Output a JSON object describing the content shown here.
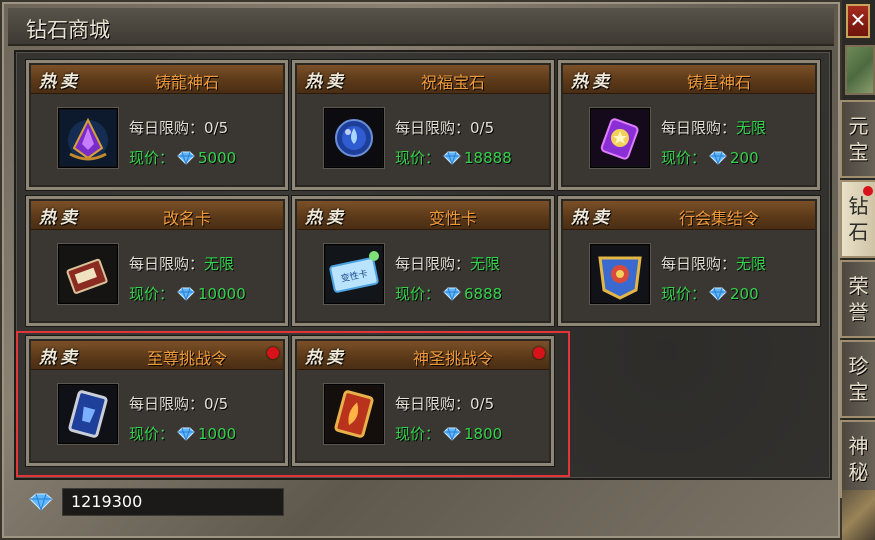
{
  "window": {
    "title": "钻石商城",
    "close_label": "✕"
  },
  "hot_label": "热卖",
  "limit_label": "每日限购：",
  "price_label": "现价：",
  "items": [
    {
      "name": "铸龍神石",
      "limit": "0/5",
      "price": "5000",
      "icon": "purple-dragon-stone-icon"
    },
    {
      "name": "祝福宝石",
      "limit": "0/5",
      "price": "18888",
      "icon": "blue-orb-gem-icon"
    },
    {
      "name": "铸星神石",
      "limit": "无限",
      "price": "200",
      "icon": "purple-star-stone-icon"
    },
    {
      "name": "改名卡",
      "limit": "无限",
      "price": "10000",
      "icon": "rename-card-icon"
    },
    {
      "name": "变性卡",
      "limit": "无限",
      "price": "6888",
      "icon": "gender-change-card-icon",
      "icon_text": "变性卡"
    },
    {
      "name": "行会集结令",
      "limit": "无限",
      "price": "200",
      "icon": "guild-rally-token-icon"
    },
    {
      "name": "至尊挑战令",
      "limit": "0/5",
      "price": "1000",
      "icon": "supreme-challenge-token-icon"
    },
    {
      "name": "神圣挑战令",
      "limit": "0/5",
      "price": "1800",
      "icon": "sacred-challenge-token-icon"
    }
  ],
  "balance": "1219300",
  "side_tabs": [
    {
      "label": "元宝",
      "active": false
    },
    {
      "label": "钻石",
      "active": true
    },
    {
      "label": "荣誉",
      "active": false
    },
    {
      "label": "珍宝",
      "active": false
    },
    {
      "label": "神秘",
      "active": false
    }
  ],
  "colors": {
    "price_green": "#35d24b",
    "item_name_orange": "#f29a3a",
    "highlight_red": "#e2353a"
  }
}
